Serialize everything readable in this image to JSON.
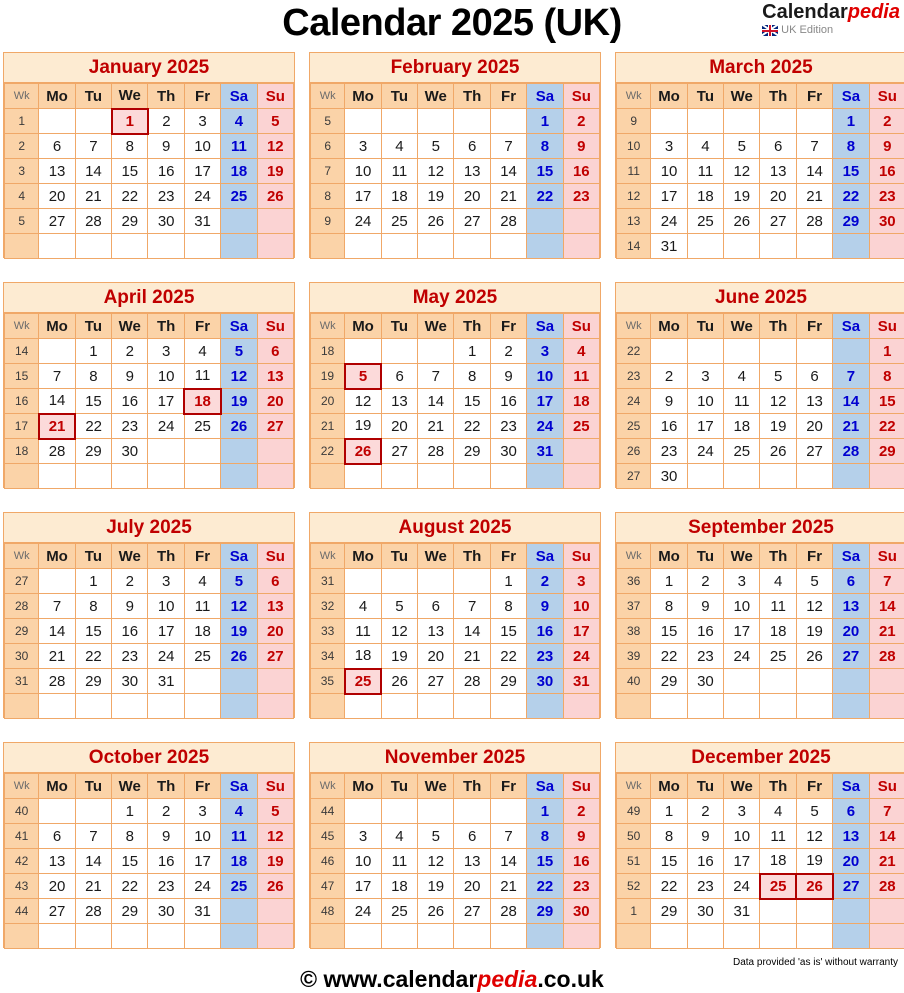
{
  "header": {
    "title": "Calendar 2025 (UK)",
    "brand_part1": "Calendar",
    "brand_part2": "pedia",
    "brand_sub": "UK Edition",
    "flag_icon": "uk-flag-icon"
  },
  "labels": {
    "wk": "Wk",
    "weekdays": [
      "Mo",
      "Tu",
      "We",
      "Th",
      "Fr",
      "Sa",
      "Su"
    ]
  },
  "colors": {
    "title_text": "#c00000",
    "title_bg": "#fdebd2",
    "border": "#f0a868",
    "header_bg": "#fbd3a8",
    "saturday_bg": "#b5d0ea",
    "saturday_text": "#0000d0",
    "sunday_bg": "#fbd3d3",
    "sunday_text": "#c00000",
    "holiday_border": "#b00000",
    "holiday_bg": "#fcdada",
    "brand_accent": "#e00000"
  },
  "footer": {
    "disclaimer": "Data provided 'as is' without warranty",
    "copyright_symbol": "©",
    "site_part1": " www.calendar",
    "site_part2": "pedia",
    "site_part3": ".co.uk"
  },
  "months": [
    {
      "name": "January 2025",
      "weeks": [
        {
          "wk": "1",
          "days": [
            "",
            "",
            "1",
            "2",
            "3",
            "4",
            "5"
          ],
          "holidays": [
            2
          ]
        },
        {
          "wk": "2",
          "days": [
            "6",
            "7",
            "8",
            "9",
            "10",
            "11",
            "12"
          ],
          "holidays": []
        },
        {
          "wk": "3",
          "days": [
            "13",
            "14",
            "15",
            "16",
            "17",
            "18",
            "19"
          ],
          "holidays": []
        },
        {
          "wk": "4",
          "days": [
            "20",
            "21",
            "22",
            "23",
            "24",
            "25",
            "26"
          ],
          "holidays": []
        },
        {
          "wk": "5",
          "days": [
            "27",
            "28",
            "29",
            "30",
            "31",
            "",
            ""
          ],
          "holidays": []
        },
        {
          "wk": "",
          "days": [
            "",
            "",
            "",
            "",
            "",
            "",
            ""
          ],
          "holidays": []
        }
      ]
    },
    {
      "name": "February 2025",
      "weeks": [
        {
          "wk": "5",
          "days": [
            "",
            "",
            "",
            "",
            "",
            "1",
            "2"
          ],
          "holidays": []
        },
        {
          "wk": "6",
          "days": [
            "3",
            "4",
            "5",
            "6",
            "7",
            "8",
            "9"
          ],
          "holidays": []
        },
        {
          "wk": "7",
          "days": [
            "10",
            "11",
            "12",
            "13",
            "14",
            "15",
            "16"
          ],
          "holidays": []
        },
        {
          "wk": "8",
          "days": [
            "17",
            "18",
            "19",
            "20",
            "21",
            "22",
            "23"
          ],
          "holidays": []
        },
        {
          "wk": "9",
          "days": [
            "24",
            "25",
            "26",
            "27",
            "28",
            "",
            ""
          ],
          "holidays": []
        },
        {
          "wk": "",
          "days": [
            "",
            "",
            "",
            "",
            "",
            "",
            ""
          ],
          "holidays": []
        }
      ]
    },
    {
      "name": "March 2025",
      "weeks": [
        {
          "wk": "9",
          "days": [
            "",
            "",
            "",
            "",
            "",
            "1",
            "2"
          ],
          "holidays": []
        },
        {
          "wk": "10",
          "days": [
            "3",
            "4",
            "5",
            "6",
            "7",
            "8",
            "9"
          ],
          "holidays": []
        },
        {
          "wk": "11",
          "days": [
            "10",
            "11",
            "12",
            "13",
            "14",
            "15",
            "16"
          ],
          "holidays": []
        },
        {
          "wk": "12",
          "days": [
            "17",
            "18",
            "19",
            "20",
            "21",
            "22",
            "23"
          ],
          "holidays": []
        },
        {
          "wk": "13",
          "days": [
            "24",
            "25",
            "26",
            "27",
            "28",
            "29",
            "30"
          ],
          "holidays": []
        },
        {
          "wk": "14",
          "days": [
            "31",
            "",
            "",
            "",
            "",
            "",
            ""
          ],
          "holidays": []
        }
      ]
    },
    {
      "name": "April 2025",
      "weeks": [
        {
          "wk": "14",
          "days": [
            "",
            "1",
            "2",
            "3",
            "4",
            "5",
            "6"
          ],
          "holidays": []
        },
        {
          "wk": "15",
          "days": [
            "7",
            "8",
            "9",
            "10",
            "11",
            "12",
            "13"
          ],
          "holidays": []
        },
        {
          "wk": "16",
          "days": [
            "14",
            "15",
            "16",
            "17",
            "18",
            "19",
            "20"
          ],
          "holidays": [
            4
          ]
        },
        {
          "wk": "17",
          "days": [
            "21",
            "22",
            "23",
            "24",
            "25",
            "26",
            "27"
          ],
          "holidays": [
            0
          ]
        },
        {
          "wk": "18",
          "days": [
            "28",
            "29",
            "30",
            "",
            "",
            "",
            ""
          ],
          "holidays": []
        },
        {
          "wk": "",
          "days": [
            "",
            "",
            "",
            "",
            "",
            "",
            ""
          ],
          "holidays": []
        }
      ]
    },
    {
      "name": "May 2025",
      "weeks": [
        {
          "wk": "18",
          "days": [
            "",
            "",
            "",
            "1",
            "2",
            "3",
            "4"
          ],
          "holidays": []
        },
        {
          "wk": "19",
          "days": [
            "5",
            "6",
            "7",
            "8",
            "9",
            "10",
            "11"
          ],
          "holidays": [
            0
          ]
        },
        {
          "wk": "20",
          "days": [
            "12",
            "13",
            "14",
            "15",
            "16",
            "17",
            "18"
          ],
          "holidays": []
        },
        {
          "wk": "21",
          "days": [
            "19",
            "20",
            "21",
            "22",
            "23",
            "24",
            "25"
          ],
          "holidays": []
        },
        {
          "wk": "22",
          "days": [
            "26",
            "27",
            "28",
            "29",
            "30",
            "31",
            ""
          ],
          "holidays": [
            0
          ]
        },
        {
          "wk": "",
          "days": [
            "",
            "",
            "",
            "",
            "",
            "",
            ""
          ],
          "holidays": []
        }
      ]
    },
    {
      "name": "June 2025",
      "weeks": [
        {
          "wk": "22",
          "days": [
            "",
            "",
            "",
            "",
            "",
            "",
            "1"
          ],
          "holidays": []
        },
        {
          "wk": "23",
          "days": [
            "2",
            "3",
            "4",
            "5",
            "6",
            "7",
            "8"
          ],
          "holidays": []
        },
        {
          "wk": "24",
          "days": [
            "9",
            "10",
            "11",
            "12",
            "13",
            "14",
            "15"
          ],
          "holidays": []
        },
        {
          "wk": "25",
          "days": [
            "16",
            "17",
            "18",
            "19",
            "20",
            "21",
            "22"
          ],
          "holidays": []
        },
        {
          "wk": "26",
          "days": [
            "23",
            "24",
            "25",
            "26",
            "27",
            "28",
            "29"
          ],
          "holidays": []
        },
        {
          "wk": "27",
          "days": [
            "30",
            "",
            "",
            "",
            "",
            "",
            ""
          ],
          "holidays": []
        }
      ]
    },
    {
      "name": "July 2025",
      "weeks": [
        {
          "wk": "27",
          "days": [
            "",
            "1",
            "2",
            "3",
            "4",
            "5",
            "6"
          ],
          "holidays": []
        },
        {
          "wk": "28",
          "days": [
            "7",
            "8",
            "9",
            "10",
            "11",
            "12",
            "13"
          ],
          "holidays": []
        },
        {
          "wk": "29",
          "days": [
            "14",
            "15",
            "16",
            "17",
            "18",
            "19",
            "20"
          ],
          "holidays": []
        },
        {
          "wk": "30",
          "days": [
            "21",
            "22",
            "23",
            "24",
            "25",
            "26",
            "27"
          ],
          "holidays": []
        },
        {
          "wk": "31",
          "days": [
            "28",
            "29",
            "30",
            "31",
            "",
            "",
            ""
          ],
          "holidays": []
        },
        {
          "wk": "",
          "days": [
            "",
            "",
            "",
            "",
            "",
            "",
            ""
          ],
          "holidays": []
        }
      ]
    },
    {
      "name": "August 2025",
      "weeks": [
        {
          "wk": "31",
          "days": [
            "",
            "",
            "",
            "",
            "1",
            "2",
            "3"
          ],
          "holidays": []
        },
        {
          "wk": "32",
          "days": [
            "4",
            "5",
            "6",
            "7",
            "8",
            "9",
            "10"
          ],
          "holidays": []
        },
        {
          "wk": "33",
          "days": [
            "11",
            "12",
            "13",
            "14",
            "15",
            "16",
            "17"
          ],
          "holidays": []
        },
        {
          "wk": "34",
          "days": [
            "18",
            "19",
            "20",
            "21",
            "22",
            "23",
            "24"
          ],
          "holidays": []
        },
        {
          "wk": "35",
          "days": [
            "25",
            "26",
            "27",
            "28",
            "29",
            "30",
            "31"
          ],
          "holidays": [
            0
          ]
        },
        {
          "wk": "",
          "days": [
            "",
            "",
            "",
            "",
            "",
            "",
            ""
          ],
          "holidays": []
        }
      ]
    },
    {
      "name": "September 2025",
      "weeks": [
        {
          "wk": "36",
          "days": [
            "1",
            "2",
            "3",
            "4",
            "5",
            "6",
            "7"
          ],
          "holidays": []
        },
        {
          "wk": "37",
          "days": [
            "8",
            "9",
            "10",
            "11",
            "12",
            "13",
            "14"
          ],
          "holidays": []
        },
        {
          "wk": "38",
          "days": [
            "15",
            "16",
            "17",
            "18",
            "19",
            "20",
            "21"
          ],
          "holidays": []
        },
        {
          "wk": "39",
          "days": [
            "22",
            "23",
            "24",
            "25",
            "26",
            "27",
            "28"
          ],
          "holidays": []
        },
        {
          "wk": "40",
          "days": [
            "29",
            "30",
            "",
            "",
            "",
            "",
            ""
          ],
          "holidays": []
        },
        {
          "wk": "",
          "days": [
            "",
            "",
            "",
            "",
            "",
            "",
            ""
          ],
          "holidays": []
        }
      ]
    },
    {
      "name": "October 2025",
      "weeks": [
        {
          "wk": "40",
          "days": [
            "",
            "",
            "1",
            "2",
            "3",
            "4",
            "5"
          ],
          "holidays": []
        },
        {
          "wk": "41",
          "days": [
            "6",
            "7",
            "8",
            "9",
            "10",
            "11",
            "12"
          ],
          "holidays": []
        },
        {
          "wk": "42",
          "days": [
            "13",
            "14",
            "15",
            "16",
            "17",
            "18",
            "19"
          ],
          "holidays": []
        },
        {
          "wk": "43",
          "days": [
            "20",
            "21",
            "22",
            "23",
            "24",
            "25",
            "26"
          ],
          "holidays": []
        },
        {
          "wk": "44",
          "days": [
            "27",
            "28",
            "29",
            "30",
            "31",
            "",
            ""
          ],
          "holidays": []
        },
        {
          "wk": "",
          "days": [
            "",
            "",
            "",
            "",
            "",
            "",
            ""
          ],
          "holidays": []
        }
      ]
    },
    {
      "name": "November 2025",
      "weeks": [
        {
          "wk": "44",
          "days": [
            "",
            "",
            "",
            "",
            "",
            "1",
            "2"
          ],
          "holidays": []
        },
        {
          "wk": "45",
          "days": [
            "3",
            "4",
            "5",
            "6",
            "7",
            "8",
            "9"
          ],
          "holidays": []
        },
        {
          "wk": "46",
          "days": [
            "10",
            "11",
            "12",
            "13",
            "14",
            "15",
            "16"
          ],
          "holidays": []
        },
        {
          "wk": "47",
          "days": [
            "17",
            "18",
            "19",
            "20",
            "21",
            "22",
            "23"
          ],
          "holidays": []
        },
        {
          "wk": "48",
          "days": [
            "24",
            "25",
            "26",
            "27",
            "28",
            "29",
            "30"
          ],
          "holidays": []
        },
        {
          "wk": "",
          "days": [
            "",
            "",
            "",
            "",
            "",
            "",
            ""
          ],
          "holidays": []
        }
      ]
    },
    {
      "name": "December 2025",
      "weeks": [
        {
          "wk": "49",
          "days": [
            "1",
            "2",
            "3",
            "4",
            "5",
            "6",
            "7"
          ],
          "holidays": []
        },
        {
          "wk": "50",
          "days": [
            "8",
            "9",
            "10",
            "11",
            "12",
            "13",
            "14"
          ],
          "holidays": []
        },
        {
          "wk": "51",
          "days": [
            "15",
            "16",
            "17",
            "18",
            "19",
            "20",
            "21"
          ],
          "holidays": []
        },
        {
          "wk": "52",
          "days": [
            "22",
            "23",
            "24",
            "25",
            "26",
            "27",
            "28"
          ],
          "holidays": [
            3,
            4
          ]
        },
        {
          "wk": "1",
          "days": [
            "29",
            "30",
            "31",
            "",
            "",
            "",
            ""
          ],
          "holidays": []
        },
        {
          "wk": "",
          "days": [
            "",
            "",
            "",
            "",
            "",
            "",
            ""
          ],
          "holidays": []
        }
      ]
    }
  ]
}
